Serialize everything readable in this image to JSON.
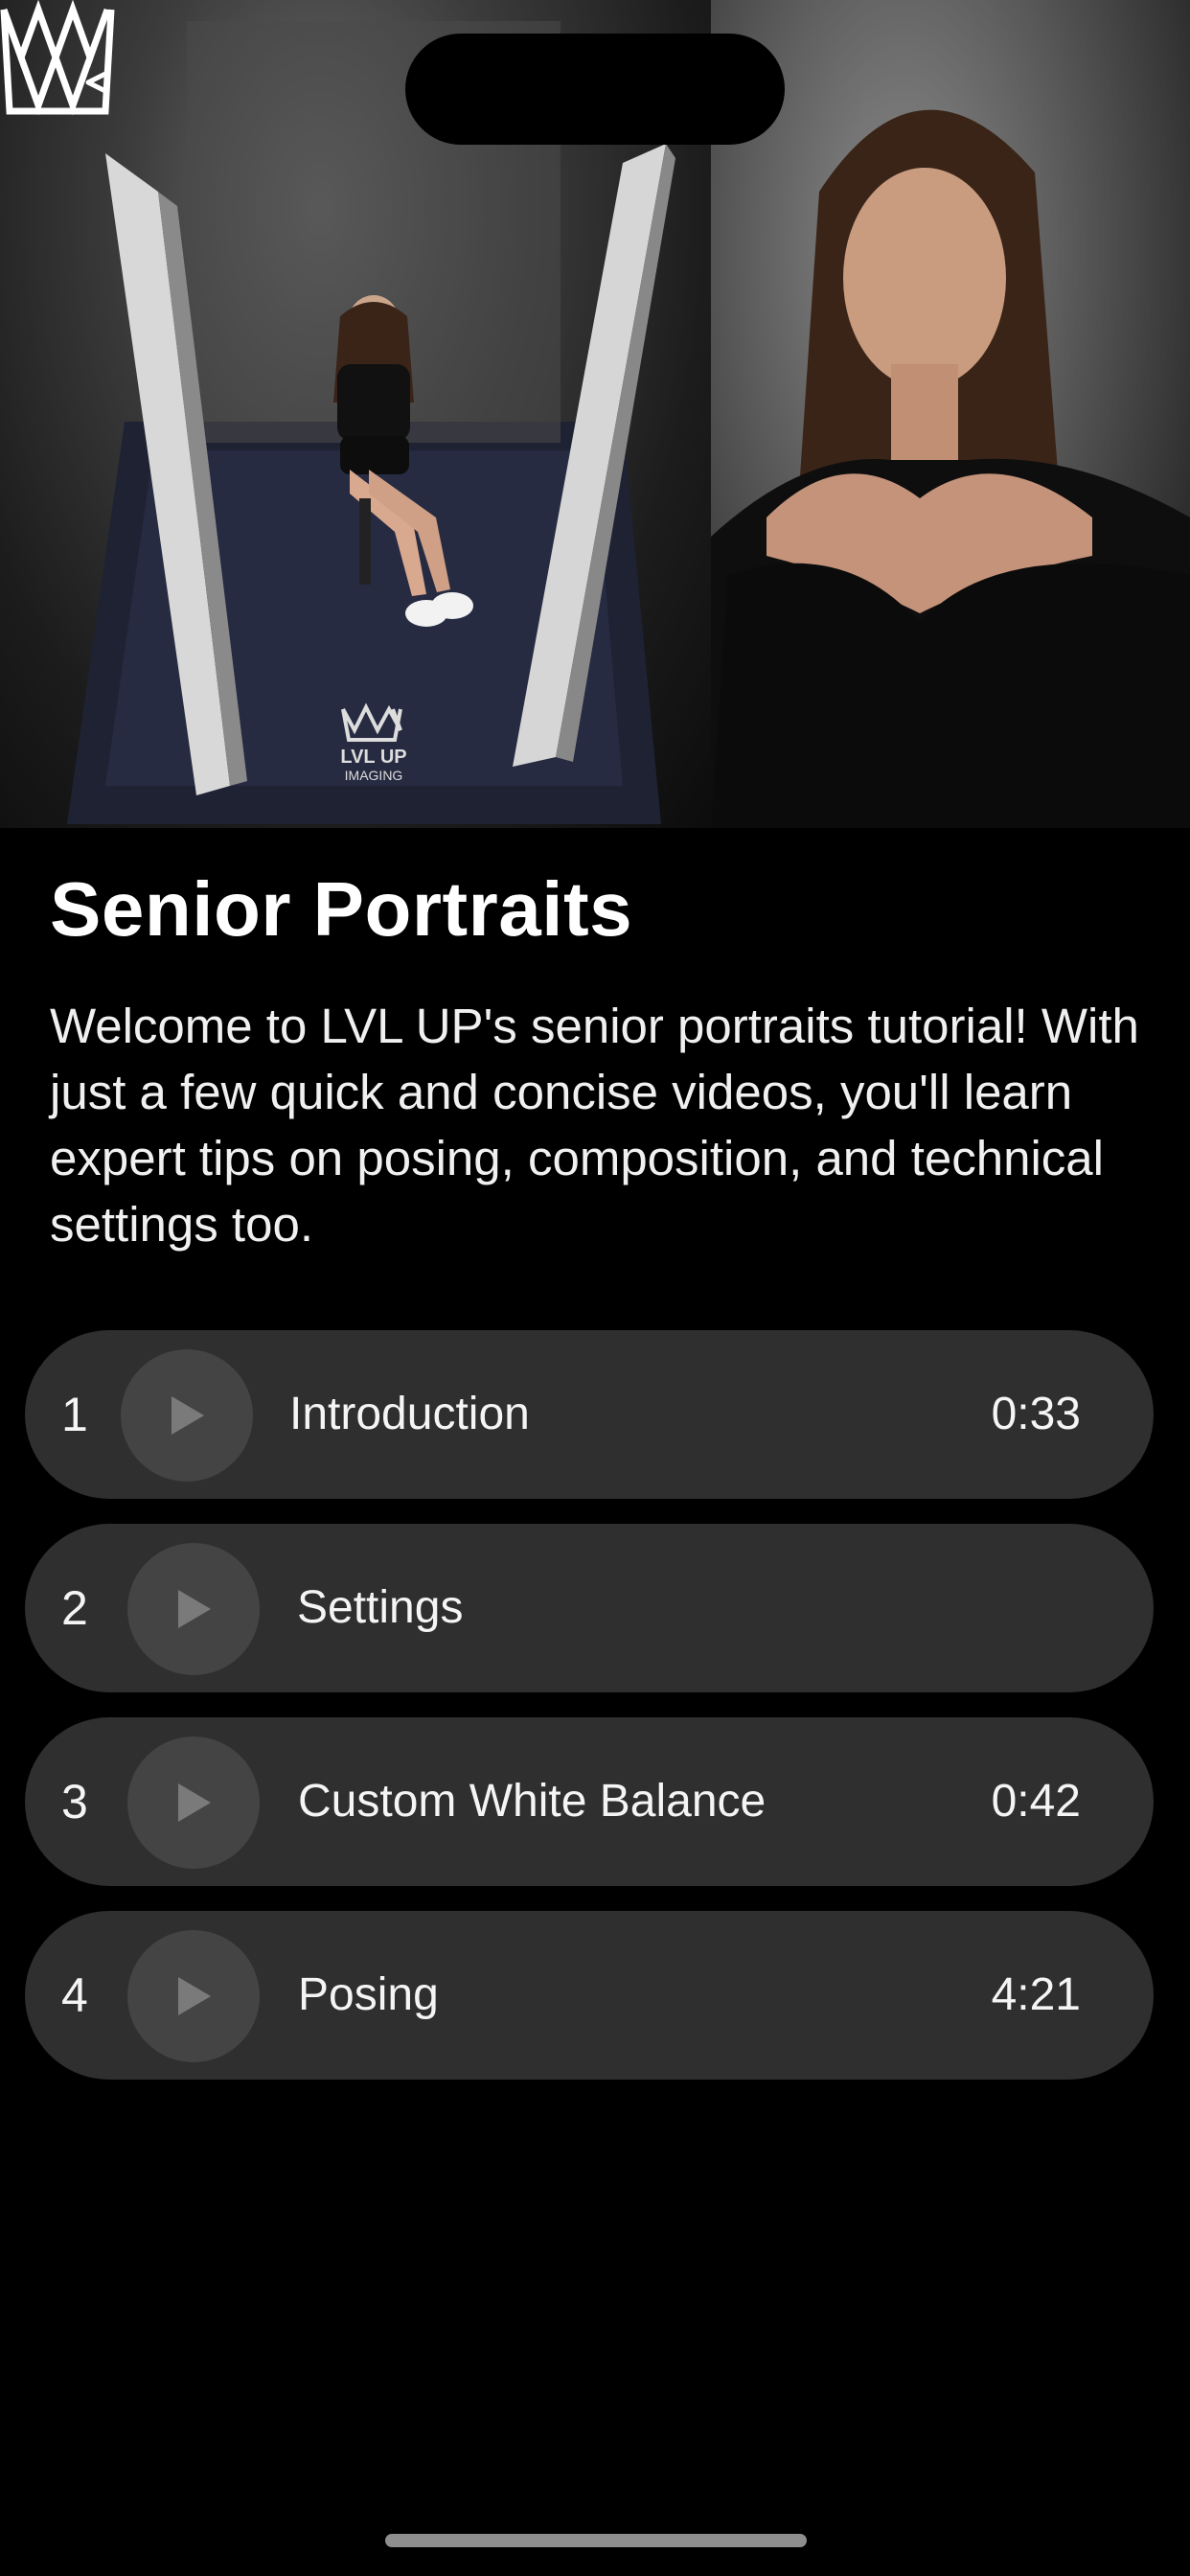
{
  "hero": {
    "left_image": "photo-studio-setup",
    "right_image": "portrait-photo",
    "studio_logo_text": [
      "LVL UP",
      "IMAGING"
    ],
    "back_label": "<",
    "logo_icon": "crown-logo-icon"
  },
  "page": {
    "title": "Senior Portraits",
    "description": "Welcome to LVL UP's senior portraits tutorial! With just a few quick and concise videos, you'll learn expert tips on posing, composition, and technical settings too."
  },
  "videos": [
    {
      "num": "1",
      "title": "Introduction",
      "duration": "0:33"
    },
    {
      "num": "2",
      "title": "Settings",
      "duration": ""
    },
    {
      "num": "3",
      "title": "Custom White Balance",
      "duration": "0:42"
    },
    {
      "num": "4",
      "title": "Posing",
      "duration": "4:21"
    }
  ],
  "colors": {
    "background": "#000000",
    "card": "#2f2f2f",
    "play_button": "#444444",
    "text": "#ffffff"
  }
}
